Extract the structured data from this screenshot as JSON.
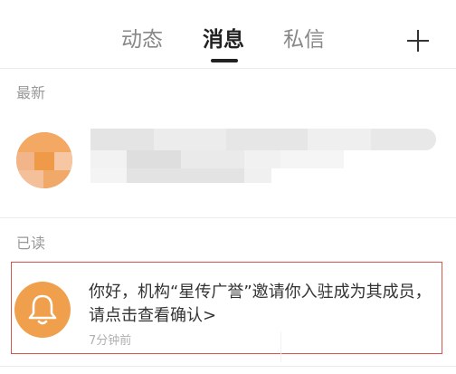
{
  "tabs": [
    {
      "label": "动态",
      "active": false
    },
    {
      "label": "消息",
      "active": true
    },
    {
      "label": "私信",
      "active": false
    }
  ],
  "actions": {
    "add_icon": "plus-icon"
  },
  "sections": {
    "latest": "最新",
    "read": "已读"
  },
  "latest_item": {
    "avatar_color": "#f0a05a",
    "content_blurred": true
  },
  "read_item": {
    "icon": "bell-icon",
    "avatar_color": "#f0a04c",
    "message": "你好，机构“星传广誉”邀请你入驻成为其成员，请点击查看确认>",
    "time": "7分钟前"
  }
}
